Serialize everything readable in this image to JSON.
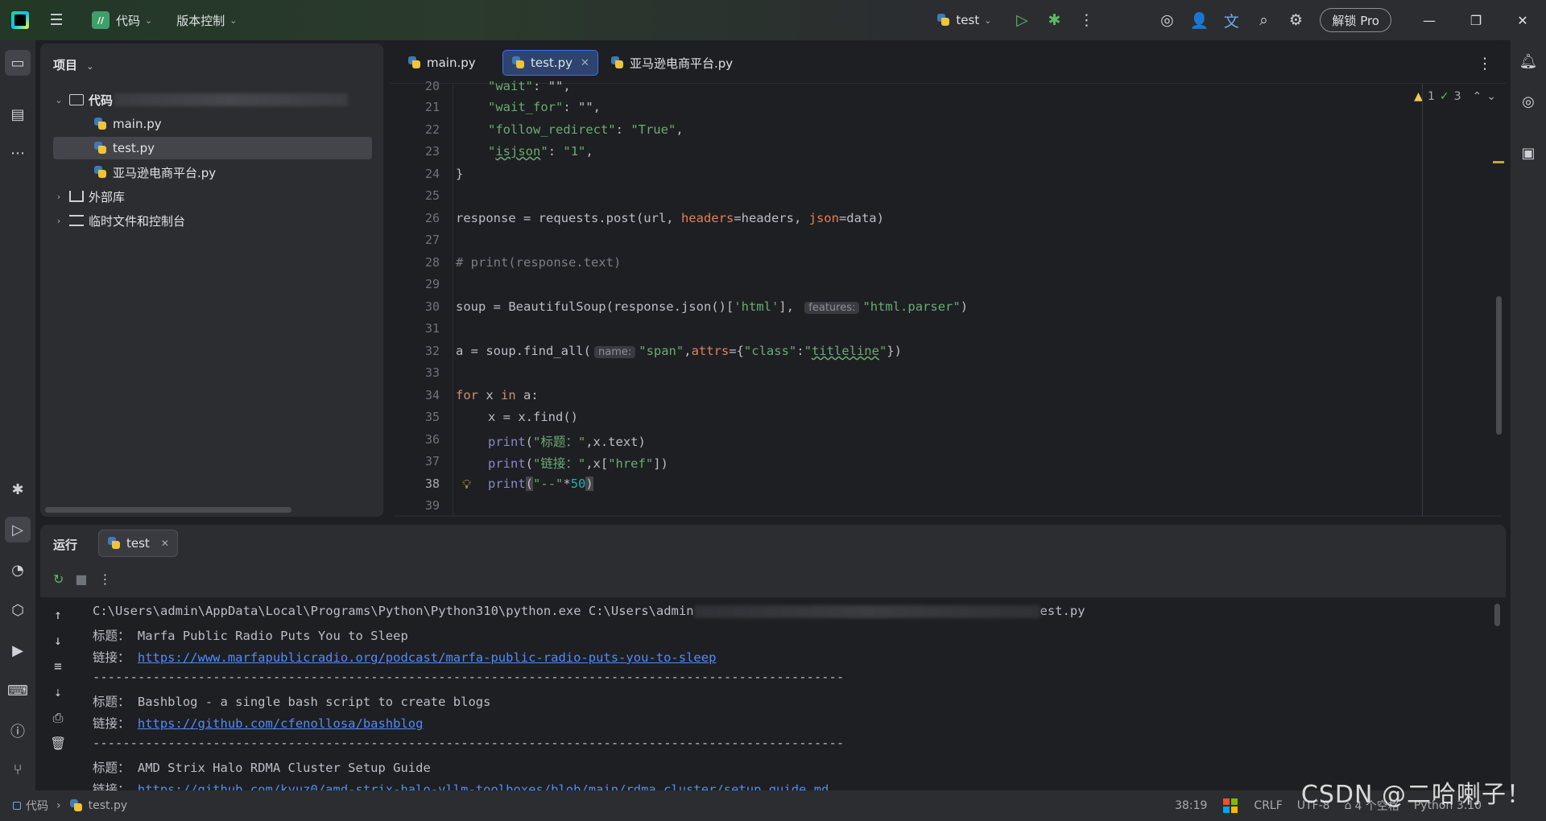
{
  "titlebar": {
    "project_badge": "//",
    "project_name": "代码",
    "vcs": "版本控制",
    "run_config": "test",
    "unlock_pro": "解锁 Pro",
    "icons": [
      "hamburger-icon",
      "play-icon",
      "bug-icon",
      "more-vertical-icon",
      "ai-assistant-icon",
      "add-user-icon",
      "translate-icon",
      "search-icon",
      "settings-icon",
      "minimize-icon",
      "restore-icon",
      "close-icon"
    ]
  },
  "project_panel": {
    "title": "项目",
    "root_folder": "代码",
    "files": [
      "main.py",
      "test.py",
      "亚马逊电商平台.py"
    ],
    "external_libs": "外部库",
    "scratches": "临时文件和控制台"
  },
  "editor": {
    "tabs": [
      {
        "label": "main.py"
      },
      {
        "label": "test.py"
      },
      {
        "label": "亚马逊电商平台.py"
      }
    ],
    "inspections": {
      "warnings": "1",
      "weak_warnings": "3"
    },
    "cursor_line": "38",
    "line_numbers": [
      "20",
      "21",
      "22",
      "23",
      "24",
      "25",
      "26",
      "27",
      "28",
      "29",
      "30",
      "31",
      "32",
      "33",
      "34",
      "35",
      "36",
      "37",
      "38",
      "39"
    ],
    "code": {
      "l20_key": "\"wait\"",
      "l20_rest": ": \"\",",
      "l21_key": "\"wait_for\"",
      "l21_rest": ": \"\",",
      "l22_key": "\"follow_redirect\"",
      "l22_sep": ": ",
      "l22_val": "\"True\"",
      "l22_end": ",",
      "l23_q1": "\"",
      "l23_key": "isjson",
      "l23_q2": "\"",
      "l23_sep": ": ",
      "l23_val": "\"1\"",
      "l23_end": ",",
      "l24": "}",
      "l26_a": "response = requests.post(url, ",
      "l26_h": "headers",
      "l26_b": "=headers, ",
      "l26_j": "json",
      "l26_c": "=data)",
      "l28": "# print(response.text)",
      "l30_a": "soup = BeautifulSoup(response.json()[",
      "l30_s": "'html'",
      "l30_b": "], ",
      "l30_hint": "features:",
      "l30_v": "\"html.parser\"",
      "l30_c": ")",
      "l32_a": "a = soup.find_all(",
      "l32_hint": "name:",
      "l32_s": "\"span\"",
      "l32_b": ",",
      "l32_attrs": "attrs",
      "l32_c": "={",
      "l32_k": "\"class\"",
      "l32_d": ":",
      "l32_q1": "\"",
      "l32_v": "titleline",
      "l32_q2": "\"",
      "l32_e": "})",
      "l34_kw1": "for",
      "l34_a": " x ",
      "l34_kw2": "in",
      "l34_b": " a:",
      "l35": "x = x.find()",
      "l36_p": "print",
      "l36_a": "(",
      "l36_s": "\"标题：\"",
      "l36_b": ",x.text)",
      "l37_p": "print",
      "l37_a": "(",
      "l37_s": "\"链接：\"",
      "l37_b": ",x[",
      "l37_k": "\"href\"",
      "l37_c": "])",
      "l38_p": "print",
      "l38_a": "(",
      "l38_s": "\"--\"",
      "l38_b": "*",
      "l38_n": "50",
      "l38_c": ")"
    }
  },
  "run_panel": {
    "title": "运行",
    "tab_label": "test",
    "console": {
      "cmd_a": "C:\\Users\\admin\\AppData\\Local\\Programs\\Python\\Python310\\python.exe C:\\Users\\admin",
      "cmd_b": "est.py",
      "title_label": "标题：",
      "link_label": "链接：",
      "entries": [
        {
          "title": "Marfa Public Radio Puts You to Sleep",
          "link": "https://www.marfapublicradio.org/podcast/marfa-public-radio-puts-you-to-sleep"
        },
        {
          "title": "Bashblog - a single bash script to create blogs",
          "link": "https://github.com/cfenollosa/bashblog"
        },
        {
          "title": "AMD Strix Halo RDMA Cluster Setup Guide",
          "link": "https://github.com/kyuz0/amd-strix-halo-vllm-toolboxes/blob/main/rdma_cluster/setup_guide.md"
        }
      ],
      "separator": "----------------------------------------------------------------------------------------------------"
    }
  },
  "statusbar": {
    "project": "代码",
    "file": "test.py",
    "position": "38:19",
    "line_sep": "CRLF",
    "encoding": "UTF-8",
    "indent": "4 个空格",
    "interpreter": "Python 3.10"
  },
  "watermark": "CSDN @二哈喇子！"
}
